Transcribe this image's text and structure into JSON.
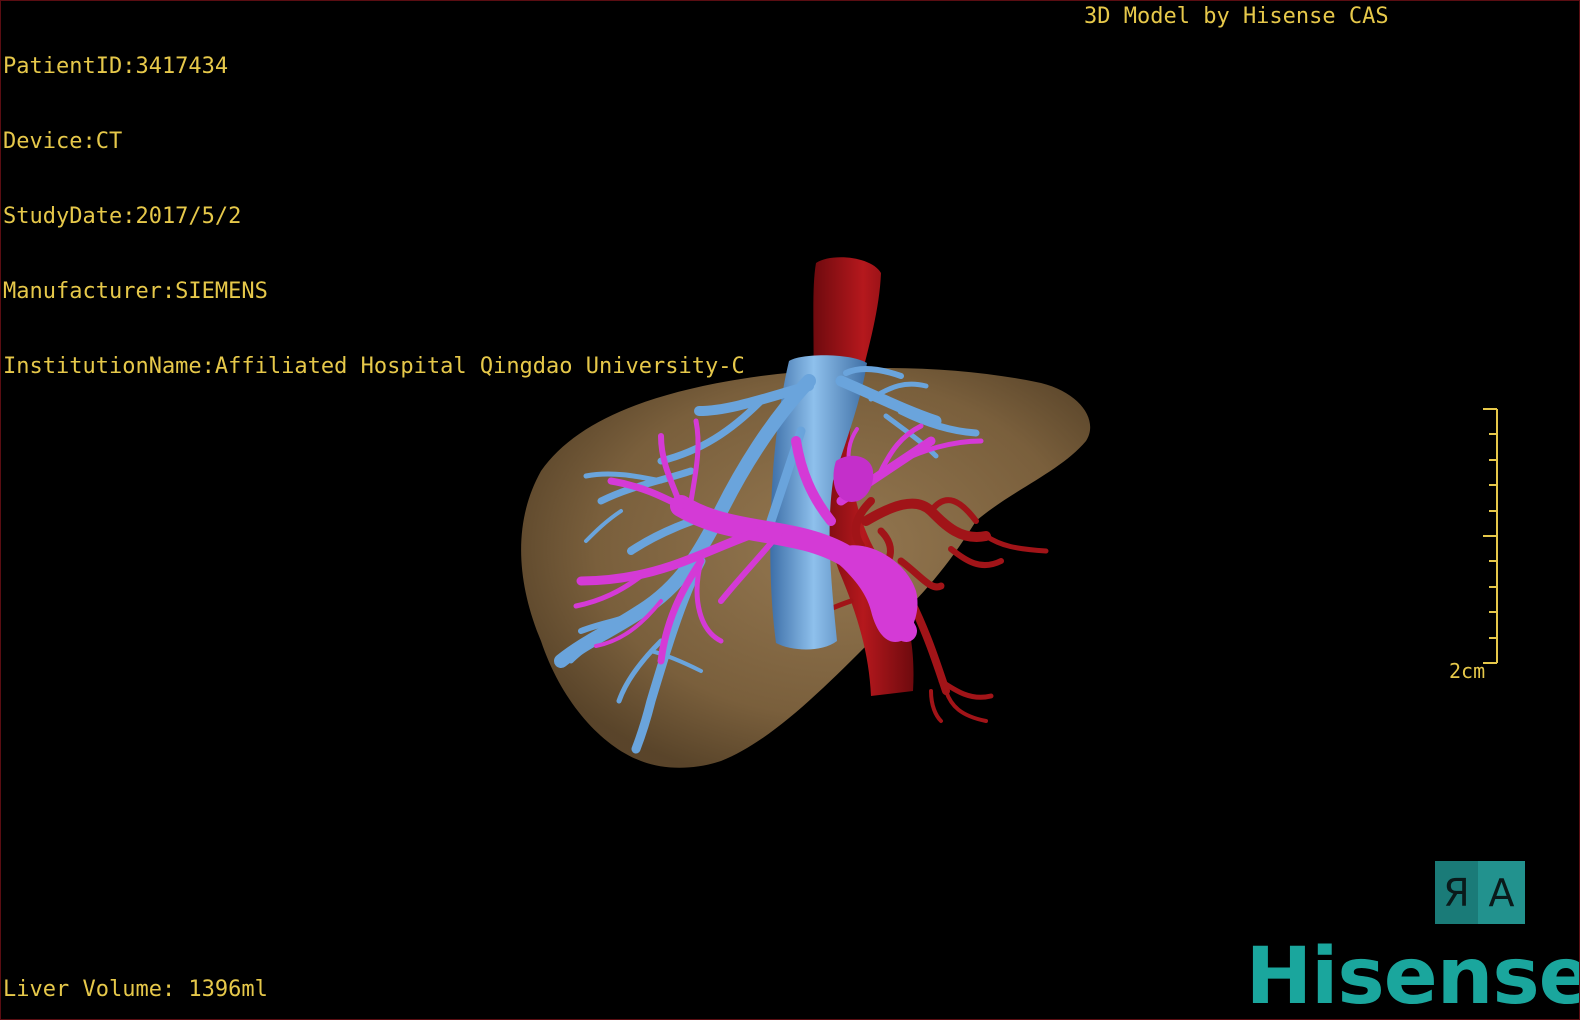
{
  "info": {
    "patient_id": "PatientID:3417434",
    "device": "Device:CT",
    "study_date": "StudyDate:2017/5/2",
    "manufacturer": "Manufacturer:SIEMENS",
    "institution": "InstitutionName:Affiliated Hospital Qingdao University-C"
  },
  "credit": "3D Model by Hisense CAS",
  "liver_volume": "Liver Volume: 1396ml",
  "scale": {
    "label": "2cm"
  },
  "orientation_cube": {
    "side_label": "Я",
    "front_label": "A"
  },
  "brand": {
    "name": "Hisense",
    "color": "#1aa69d"
  },
  "colors": {
    "overlay_text": "#e6c84a",
    "liver": "#8a6d48",
    "hepatic_vein": "#6aa4dc",
    "portal_vein": "#d43ad6",
    "artery": "#a11418"
  }
}
